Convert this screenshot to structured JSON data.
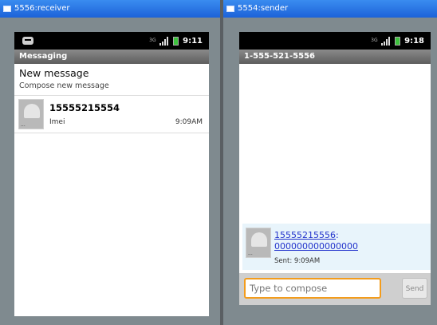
{
  "receiver": {
    "window_title": "5556:receiver",
    "status_time": "9:11",
    "app_title": "Messaging",
    "new_message": {
      "title": "New message",
      "subtitle": "Compose new message"
    },
    "conversations": [
      {
        "name": "15555215554",
        "snippet": "Imei",
        "time": "9:09AM"
      }
    ]
  },
  "sender": {
    "window_title": "5554:sender",
    "status_time": "9:18",
    "header_number": "1-555-521-5556",
    "message": {
      "from": "15555215556",
      "separator": ":",
      "body": "000000000000000",
      "status": "Sent: 9:09AM"
    },
    "compose": {
      "placeholder": "Type to compose",
      "send_label": "Send"
    }
  },
  "status_icons": {
    "network": "3G",
    "signal": "signal-icon",
    "battery": "battery-icon"
  },
  "colors": {
    "titlebar": "#1c62d8",
    "compose_focus": "#f39c1c",
    "bubble": "#e8f4fb",
    "link": "#2233cc"
  }
}
